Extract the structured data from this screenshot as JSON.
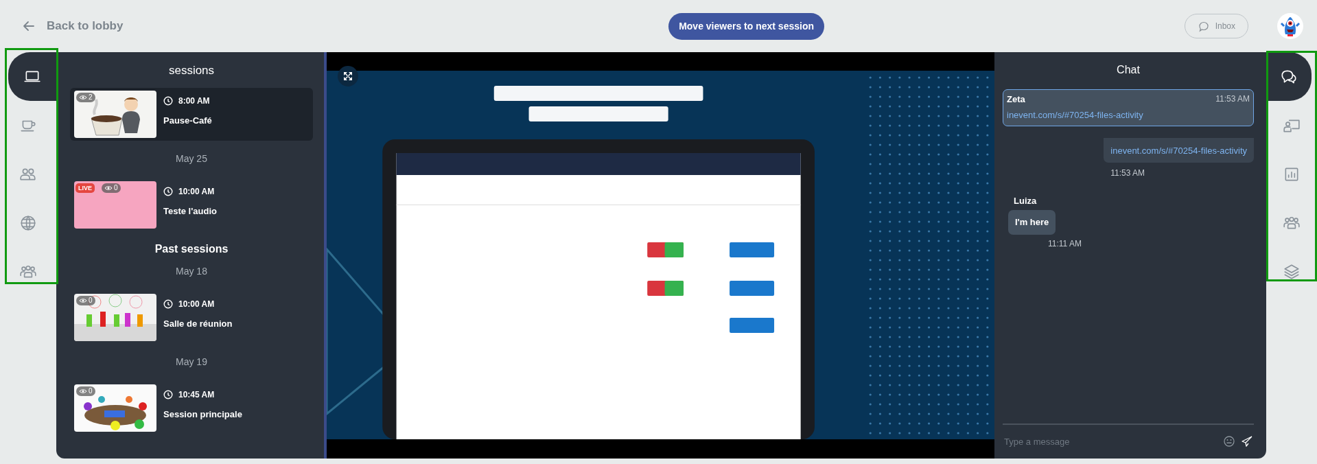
{
  "header": {
    "back_label": "Back to lobby",
    "center_button": "Move viewers to next session",
    "inbox_label": "Inbox"
  },
  "left_rail": [
    {
      "selected": true
    },
    {
      "selected": false
    },
    {
      "selected": false
    },
    {
      "selected": false
    },
    {
      "selected": false
    }
  ],
  "sessions": {
    "title": "sessions",
    "entries": [
      {
        "kind": "session",
        "time": "8:00 AM",
        "name": "Pause-Café",
        "viewers": "2",
        "live": false,
        "selected": true
      },
      {
        "kind": "date",
        "text": "May 25"
      },
      {
        "kind": "session",
        "time": "10:00 AM",
        "name": "Teste l'audio",
        "viewers": "0",
        "live": true,
        "live_label": "LIVE",
        "thumbnail": {
          "kind": "blank"
        },
        "selected": false
      },
      {
        "kind": "heading",
        "text": "Past sessions"
      },
      {
        "kind": "date",
        "text": "May 18"
      },
      {
        "kind": "session",
        "time": "10:00 AM",
        "name": "Salle de réunion",
        "viewers": "0",
        "live": false,
        "selected": false
      },
      {
        "kind": "date",
        "text": "May 19"
      },
      {
        "kind": "session",
        "time": "10:45 AM",
        "name": "Session principale",
        "viewers": "0",
        "live": false,
        "selected": false
      }
    ]
  },
  "chat": {
    "title": "Chat",
    "messages": [
      {
        "kind": "highlighted",
        "sender": "Zeta",
        "time": "11:53 AM",
        "text": "inevent.com/s/#70254-files-activity"
      },
      {
        "kind": "sent",
        "time": "11:53 AM",
        "text": "inevent.com/s/#70254-files-activity"
      },
      {
        "kind": "received",
        "sender": "Luiza",
        "time": "11:11 AM",
        "text": "I'm here"
      }
    ],
    "input": {
      "placeholder": "Type a message"
    }
  },
  "right_rail": [
    {
      "selected": true
    },
    {
      "selected": false
    },
    {
      "selected": false
    },
    {
      "selected": false
    },
    {
      "selected": false
    }
  ]
}
